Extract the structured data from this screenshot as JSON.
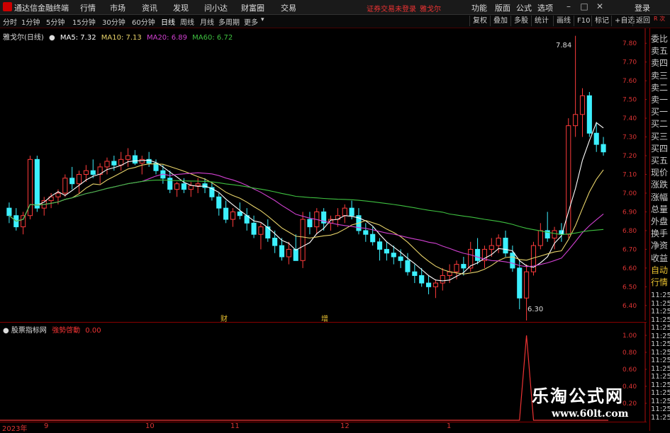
{
  "titlebar": {
    "app_name": "通达信金融终端",
    "menus": [
      "行情",
      "市场",
      "资讯",
      "发现",
      "问小达",
      "财富圈",
      "交易"
    ],
    "notice": "证券交易未登录",
    "stock_name": "雅戈尔",
    "right_menus": [
      "功能",
      "版面",
      "公式",
      "选项"
    ],
    "right_link": "登录"
  },
  "toolbar": {
    "periods": [
      "分时",
      "1分钟",
      "5分钟",
      "15分钟",
      "30分钟",
      "60分钟",
      "日线",
      "周线",
      "月线",
      "多周期",
      "更多"
    ],
    "selected": "日线",
    "buttons": [
      "复权",
      "叠加",
      "多股",
      "统计",
      "画线",
      "F10",
      "标记",
      "+自选",
      "返回"
    ]
  },
  "legend": {
    "name": "雅戈尔(日线)",
    "ma5": "MA5: 7.32",
    "ma10": "MA10: 7.13",
    "ma20": "MA20: 6.89",
    "ma60": "MA60: 6.72"
  },
  "colors": {
    "up": "#ff3b3b",
    "down": "#3cf0ff",
    "ma5": "#ffffff",
    "ma10": "#e8d36a",
    "ma20": "#d040d0",
    "ma60": "#3ec040",
    "axis": "#aa1111"
  },
  "main_axis": {
    "labels": [
      "7.80",
      "7.70",
      "7.60",
      "7.50",
      "7.40",
      "7.30",
      "7.20",
      "7.10",
      "7.00",
      "6.90",
      "6.80",
      "6.70",
      "6.60",
      "6.50",
      "6.40"
    ],
    "ylim": [
      6.32,
      7.88
    ]
  },
  "annotations": {
    "high": "7.84",
    "low": "6.30",
    "marker_cai": "财",
    "marker_zeng": "增"
  },
  "lower": {
    "name": "股票指标网",
    "indicator": "強勢啓動",
    "value": "0.00",
    "axis_labels": [
      "1.00",
      "0.80",
      "0.60",
      "0.40",
      "0.20"
    ]
  },
  "right_panel": {
    "top_label": "R 次",
    "items": [
      "委比",
      "卖五",
      "卖四",
      "卖三",
      "卖二",
      "卖一",
      "买一",
      "买二",
      "买三",
      "买四",
      "买五",
      "现价",
      "涨跌",
      "涨幅",
      "总量",
      "外盘",
      "换手",
      "净资",
      "收益",
      "自动",
      "行情"
    ],
    "times": [
      "11:25",
      "11:25",
      "11:25",
      "11:25",
      "11:25",
      "11:25",
      "11:25",
      "11:25",
      "11:25",
      "11:25",
      "11:25",
      "11:25",
      "11:25",
      "11:25",
      "11:25",
      "11:25"
    ]
  },
  "x_axis": {
    "labels": [
      "2023年",
      "9",
      "10",
      "11",
      "12",
      "1"
    ]
  },
  "watermark": {
    "title": "乐淘公式网",
    "url": "www.60lt.com"
  },
  "chart_data": {
    "type": "candlestick",
    "candles": [
      [
        6.92,
        6.95,
        6.84,
        6.88
      ],
      [
        6.88,
        6.92,
        6.8,
        6.82
      ],
      [
        6.82,
        6.9,
        6.78,
        6.88
      ],
      [
        6.88,
        7.2,
        6.86,
        7.18
      ],
      [
        7.18,
        7.2,
        6.9,
        6.92
      ],
      [
        6.92,
        6.98,
        6.88,
        6.96
      ],
      [
        6.96,
        7.0,
        6.92,
        6.98
      ],
      [
        6.98,
        7.02,
        6.94,
        7.0
      ],
      [
        7.0,
        7.1,
        6.98,
        7.08
      ],
      [
        7.08,
        7.14,
        7.02,
        7.05
      ],
      [
        7.05,
        7.12,
        7.0,
        7.1
      ],
      [
        7.1,
        7.15,
        7.06,
        7.12
      ],
      [
        7.12,
        7.18,
        7.08,
        7.1
      ],
      [
        7.1,
        7.16,
        7.05,
        7.14
      ],
      [
        7.14,
        7.19,
        7.1,
        7.17
      ],
      [
        7.17,
        7.2,
        7.12,
        7.15
      ],
      [
        7.15,
        7.22,
        7.12,
        7.18
      ],
      [
        7.18,
        7.24,
        7.14,
        7.2
      ],
      [
        7.2,
        7.23,
        7.15,
        7.16
      ],
      [
        7.16,
        7.2,
        7.1,
        7.18
      ],
      [
        7.18,
        7.22,
        7.14,
        7.16
      ],
      [
        7.16,
        7.18,
        7.1,
        7.12
      ],
      [
        7.12,
        7.15,
        7.05,
        7.08
      ],
      [
        7.08,
        7.12,
        7.0,
        7.02
      ],
      [
        7.02,
        7.06,
        6.98,
        7.05
      ],
      [
        7.05,
        7.08,
        7.0,
        7.02
      ],
      [
        7.02,
        7.06,
        6.98,
        7.04
      ],
      [
        7.04,
        7.08,
        7.0,
        7.05
      ],
      [
        7.05,
        7.08,
        7.0,
        7.03
      ],
      [
        7.03,
        7.06,
        6.96,
        6.98
      ],
      [
        6.98,
        7.0,
        6.88,
        6.92
      ],
      [
        6.92,
        6.96,
        6.84,
        6.86
      ],
      [
        6.86,
        6.92,
        6.82,
        6.9
      ],
      [
        6.9,
        6.95,
        6.86,
        6.88
      ],
      [
        6.88,
        6.92,
        6.8,
        6.84
      ],
      [
        6.84,
        6.88,
        6.76,
        6.78
      ],
      [
        6.78,
        6.84,
        6.7,
        6.82
      ],
      [
        6.82,
        6.86,
        6.74,
        6.76
      ],
      [
        6.76,
        6.8,
        6.68,
        6.72
      ],
      [
        6.72,
        6.76,
        6.64,
        6.66
      ],
      [
        6.66,
        6.74,
        6.62,
        6.7
      ],
      [
        6.7,
        6.78,
        6.66,
        6.64
      ],
      [
        6.64,
        6.9,
        6.6,
        6.86
      ],
      [
        6.86,
        6.9,
        6.78,
        6.82
      ],
      [
        6.82,
        6.92,
        6.78,
        6.9
      ],
      [
        6.9,
        6.92,
        6.8,
        6.84
      ],
      [
        6.84,
        6.88,
        6.8,
        6.86
      ],
      [
        6.86,
        6.92,
        6.82,
        6.88
      ],
      [
        6.88,
        6.94,
        6.84,
        6.92
      ],
      [
        6.92,
        6.96,
        6.86,
        6.88
      ],
      [
        6.88,
        6.92,
        6.78,
        6.8
      ],
      [
        6.8,
        6.84,
        6.74,
        6.78
      ],
      [
        6.78,
        6.82,
        6.72,
        6.74
      ],
      [
        6.74,
        6.76,
        6.64,
        6.7
      ],
      [
        6.7,
        6.74,
        6.64,
        6.68
      ],
      [
        6.68,
        6.72,
        6.62,
        6.66
      ],
      [
        6.66,
        6.7,
        6.6,
        6.64
      ],
      [
        6.64,
        6.68,
        6.56,
        6.58
      ],
      [
        6.58,
        6.62,
        6.52,
        6.56
      ],
      [
        6.56,
        6.6,
        6.5,
        6.52
      ],
      [
        6.52,
        6.56,
        6.46,
        6.5
      ],
      [
        6.5,
        6.54,
        6.44,
        6.52
      ],
      [
        6.52,
        6.6,
        6.48,
        6.56
      ],
      [
        6.56,
        6.62,
        6.52,
        6.58
      ],
      [
        6.58,
        6.64,
        6.54,
        6.62
      ],
      [
        6.62,
        6.66,
        6.56,
        6.6
      ],
      [
        6.6,
        6.74,
        6.58,
        6.7
      ],
      [
        6.7,
        6.76,
        6.62,
        6.64
      ],
      [
        6.64,
        6.72,
        6.6,
        6.7
      ],
      [
        6.7,
        6.76,
        6.66,
        6.72
      ],
      [
        6.72,
        6.78,
        6.68,
        6.76
      ],
      [
        6.76,
        6.8,
        6.66,
        6.68
      ],
      [
        6.68,
        6.72,
        6.58,
        6.6
      ],
      [
        6.6,
        6.64,
        6.38,
        6.44
      ],
      [
        6.44,
        6.62,
        6.3,
        6.58
      ],
      [
        6.58,
        6.74,
        6.56,
        6.72
      ],
      [
        6.72,
        6.84,
        6.7,
        6.8
      ],
      [
        6.8,
        6.9,
        6.74,
        6.76
      ],
      [
        6.76,
        6.82,
        6.7,
        6.8
      ],
      [
        6.8,
        6.84,
        6.74,
        6.78
      ],
      [
        6.78,
        7.4,
        6.76,
        7.36
      ],
      [
        7.36,
        7.84,
        7.3,
        7.42
      ],
      [
        7.42,
        7.56,
        7.3,
        7.52
      ],
      [
        7.52,
        7.54,
        7.3,
        7.32
      ],
      [
        7.32,
        7.38,
        7.22,
        7.26
      ],
      [
        7.26,
        7.3,
        7.2,
        7.22
      ]
    ],
    "ylim": [
      6.32,
      7.88
    ],
    "lower_series": {
      "name": "強勢啓動",
      "spike_index": 74,
      "ylim": [
        0,
        1
      ]
    }
  }
}
